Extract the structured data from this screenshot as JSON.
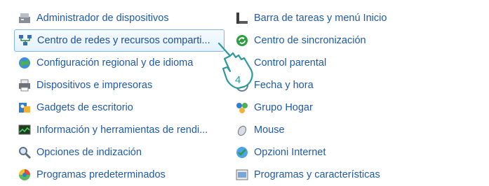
{
  "left_items": [
    {
      "label": "Administrador de dispositivos",
      "icon": "device-manager-icon"
    },
    {
      "label": "Centro de redes y recursos comparti...",
      "icon": "network-center-icon"
    },
    {
      "label": "Configuración regional y de idioma",
      "icon": "region-language-icon"
    },
    {
      "label": "Dispositivos e impresoras",
      "icon": "printer-icon"
    },
    {
      "label": "Gadgets de escritorio",
      "icon": "gadgets-icon"
    },
    {
      "label": "Información y herramientas de rendi...",
      "icon": "performance-icon"
    },
    {
      "label": "Opciones de indización",
      "icon": "indexing-icon"
    },
    {
      "label": "Programas predeterminados",
      "icon": "default-programs-icon"
    }
  ],
  "right_items": [
    {
      "label": "Barra de tareas y menú Inicio",
      "icon": "taskbar-icon"
    },
    {
      "label": "Centro de sincronización",
      "icon": "sync-icon"
    },
    {
      "label": "Control parental",
      "icon": "parental-control-icon"
    },
    {
      "label": "Fecha y hora",
      "icon": "clock-icon"
    },
    {
      "label": "Grupo Hogar",
      "icon": "homegroup-icon"
    },
    {
      "label": "Mouse",
      "icon": "mouse-icon"
    },
    {
      "label": "Opzioni Internet",
      "icon": "internet-options-icon"
    },
    {
      "label": "Programas y características",
      "icon": "programs-features-icon"
    }
  ],
  "step_badge": "4",
  "colors": {
    "link": "#1e5aa8",
    "hover_border": "#7fb6e8",
    "cursor": "#2a9a9a"
  }
}
